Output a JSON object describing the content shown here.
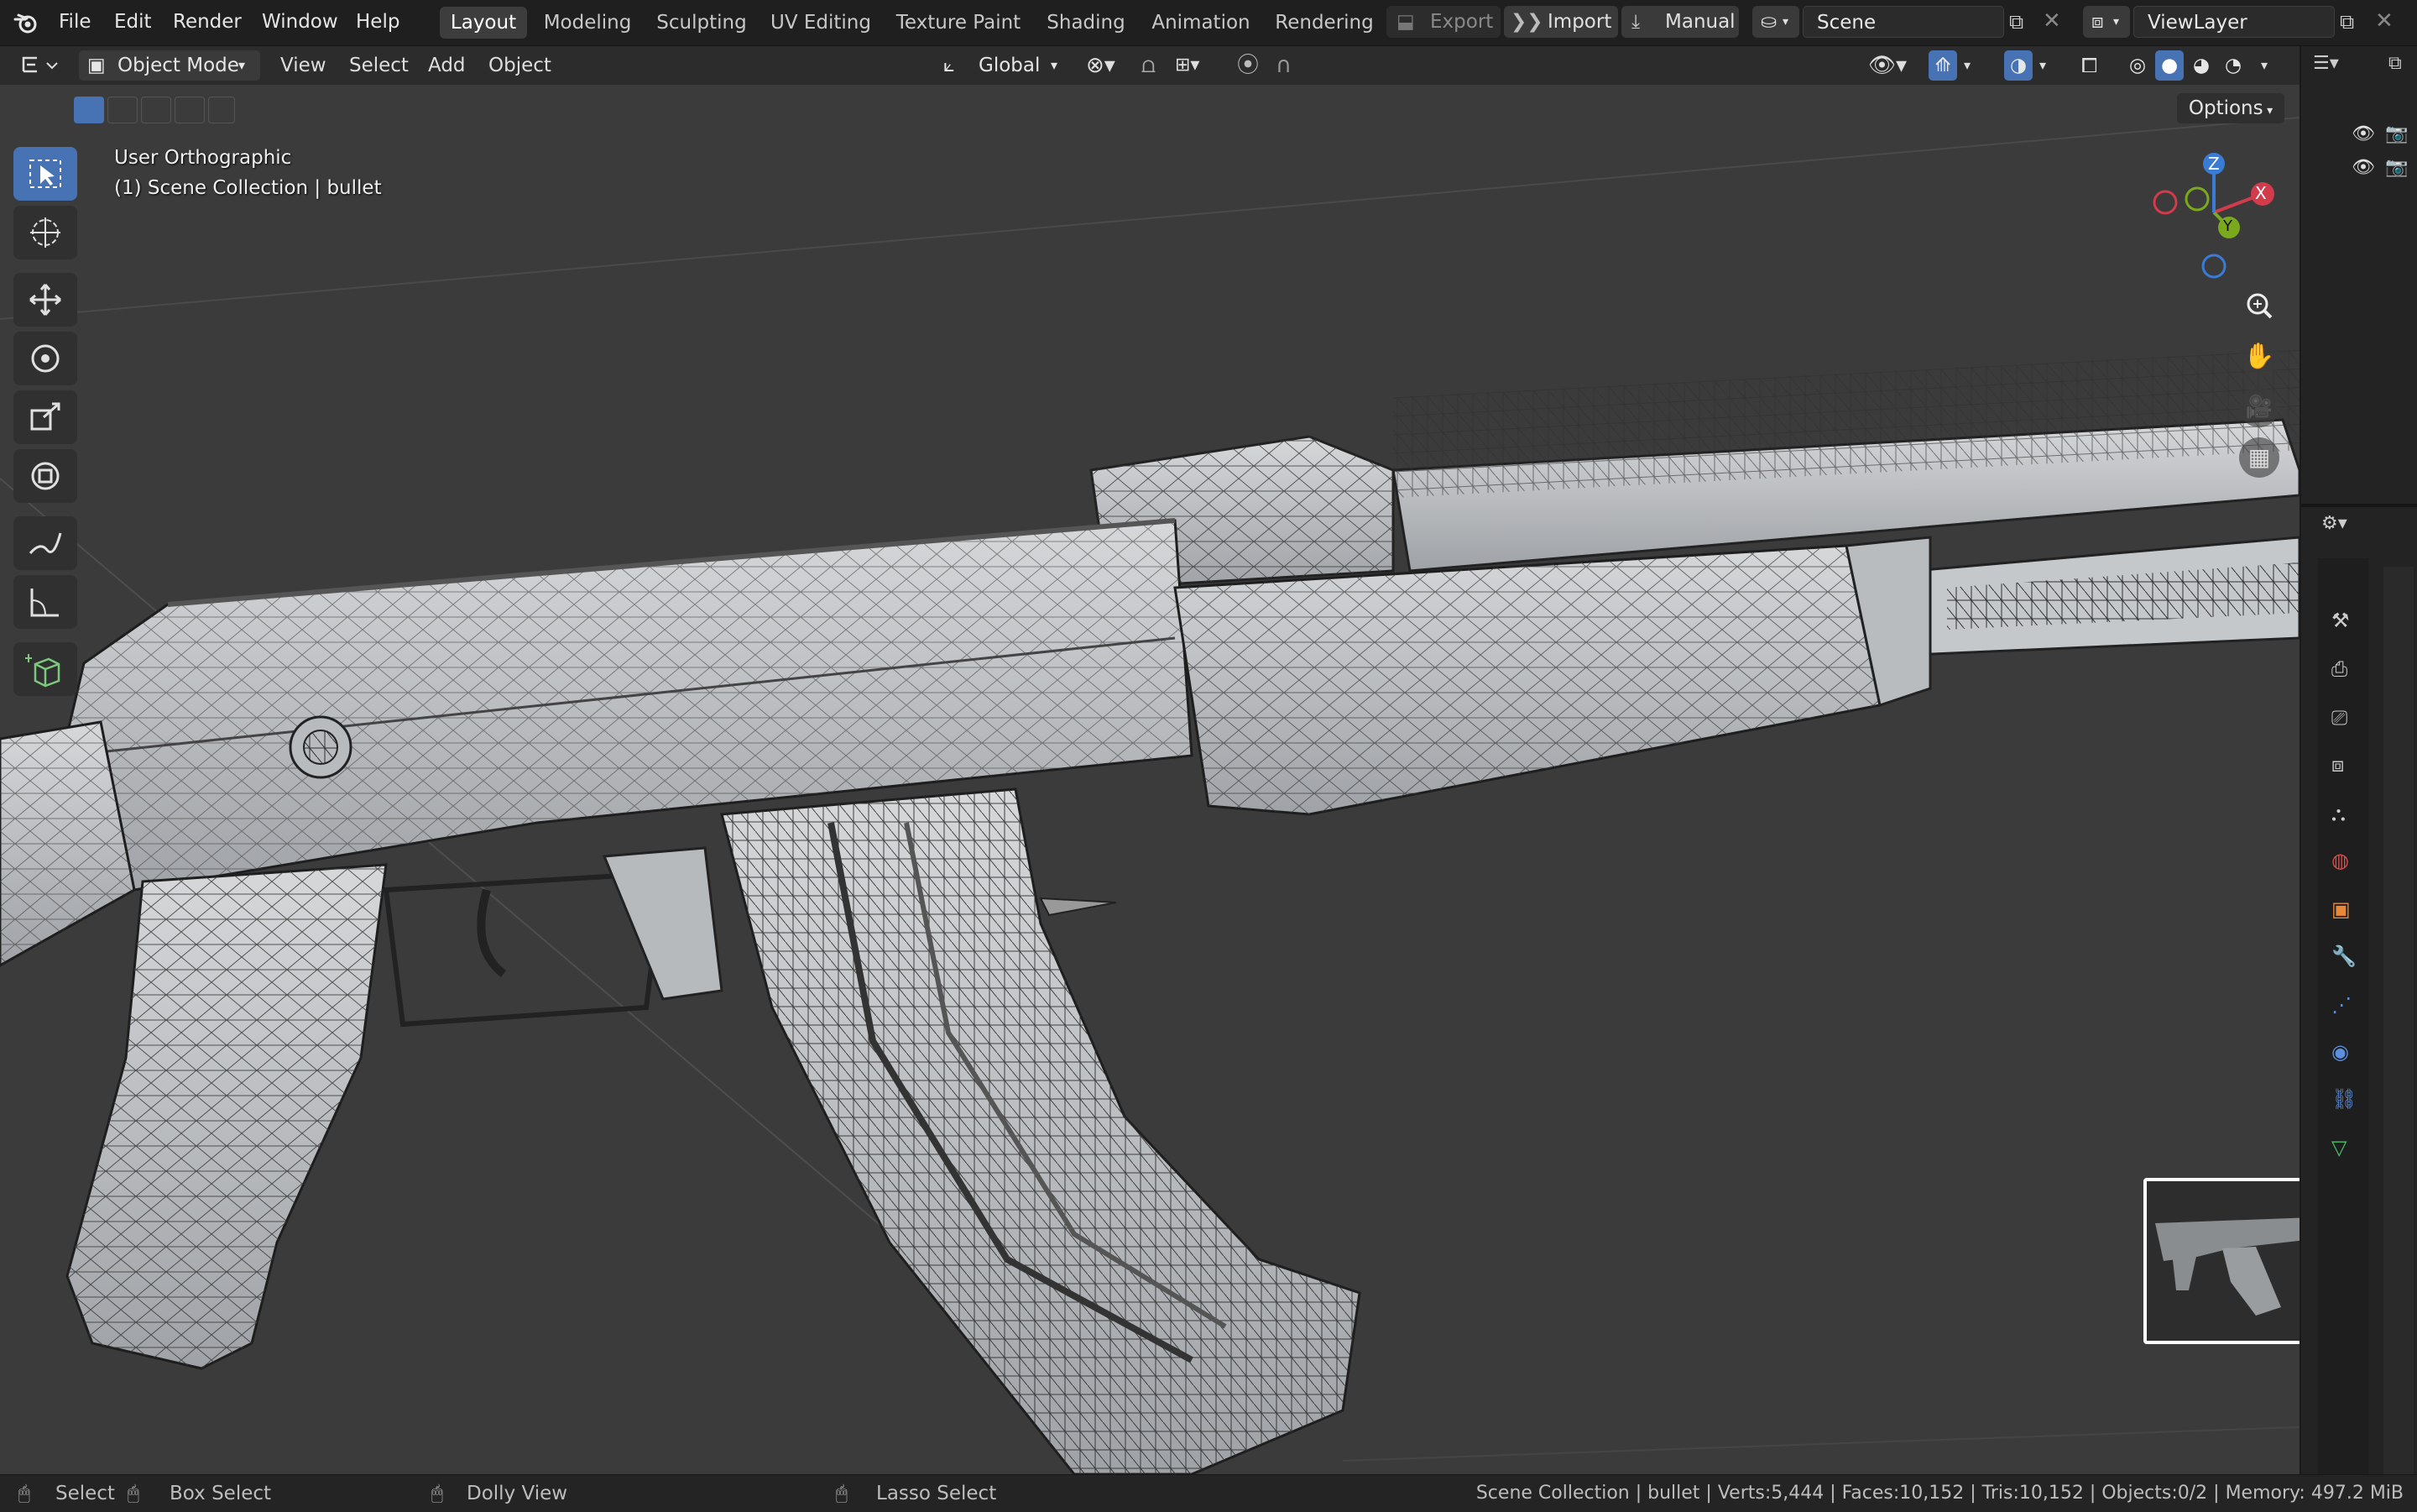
{
  "menu": {
    "file": "File",
    "edit": "Edit",
    "render": "Render",
    "window": "Window",
    "help": "Help"
  },
  "workspaces": [
    "Layout",
    "Modeling",
    "Sculpting",
    "UV Editing",
    "Texture Paint",
    "Shading",
    "Animation",
    "Rendering"
  ],
  "topbar": {
    "export": "Export",
    "import": "Import",
    "manual": "Manual",
    "scene": "Scene",
    "view_layer": "ViewLayer"
  },
  "header": {
    "mode": "Object Mode",
    "view": "View",
    "select": "Select",
    "add": "Add",
    "object": "Object",
    "orientation": "Global",
    "options": "Options"
  },
  "overlay": {
    "view_name": "User Orthographic",
    "collection": "(1) Scene Collection | bullet"
  },
  "gizmo": {
    "x": "X",
    "y": "Y",
    "z": "Z"
  },
  "status": {
    "select": "Select",
    "box_select": "Box Select",
    "dolly": "Dolly View",
    "lasso": "Lasso Select",
    "stats": "Scene Collection | bullet | Verts:5,444 | Faces:10,152 | Tris:10,152 | Objects:0/2 | Memory: 497.2 MiB"
  },
  "colors": {
    "accent": "#4772b3",
    "x_axis": "#d23b4b",
    "y_axis": "#7ba91d",
    "z_axis": "#3a7bd5"
  }
}
